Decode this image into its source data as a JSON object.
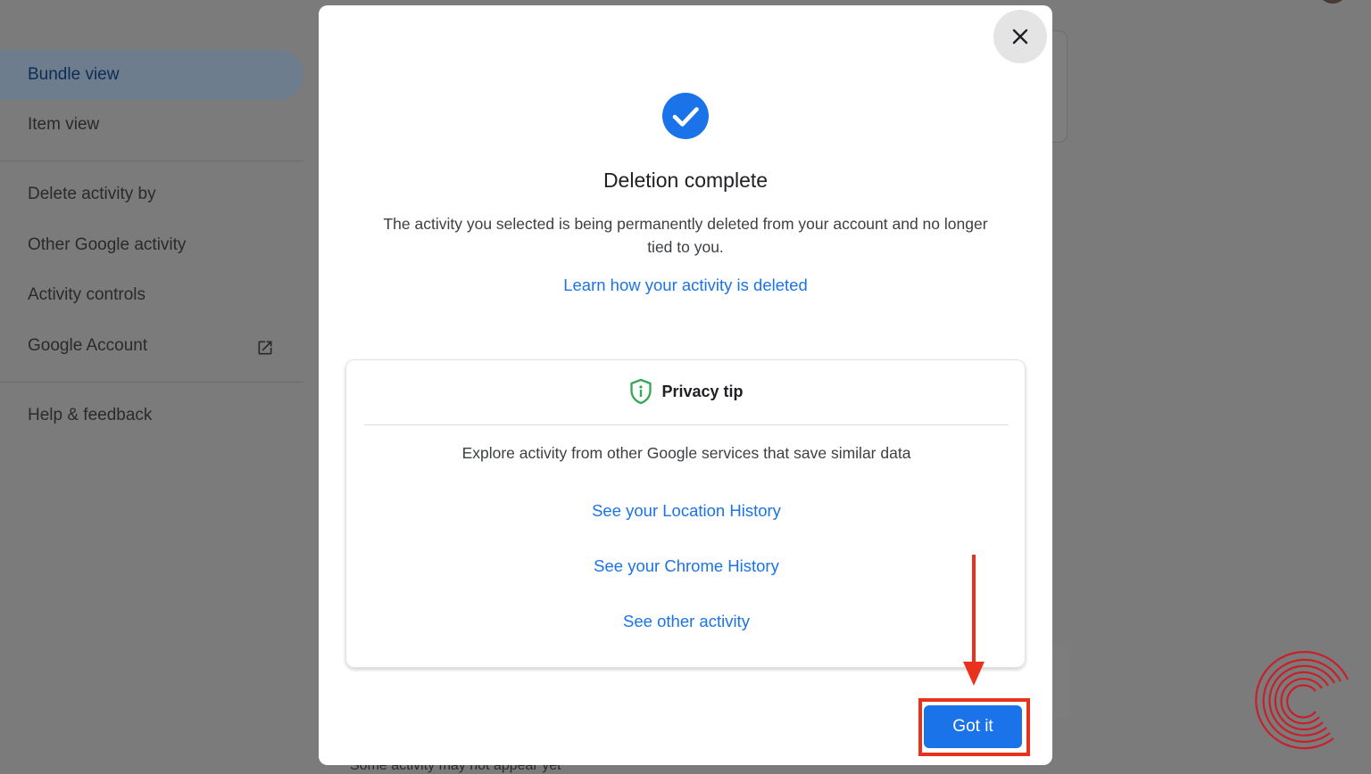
{
  "background": {
    "sidebar": {
      "items": [
        {
          "label": "Bundle view",
          "active": true
        },
        {
          "label": "Item view"
        },
        {
          "label": "Delete activity by"
        },
        {
          "label": "Other Google activity"
        },
        {
          "label": "Activity controls"
        },
        {
          "label": "Google Account",
          "icon": "open-in-new-icon"
        },
        {
          "label": "Help & feedback"
        }
      ]
    },
    "bottom_text": "Some activity may not appear yet"
  },
  "dialog": {
    "close_icon": "close-icon",
    "status_icon": "check-circle-icon",
    "title": "Deletion complete",
    "description": "The activity you selected is being permanently deleted from your account and no longer tied to you.",
    "learn_link": "Learn how your activity is deleted",
    "privacy_tip": {
      "icon": "shield-info-icon",
      "title": "Privacy tip",
      "text": "Explore activity from other Google services that save similar data",
      "links": [
        "See your Location History",
        "See your Chrome History",
        "See other activity"
      ]
    },
    "got_it_label": "Got it"
  },
  "colors": {
    "accent": "#1a73e8",
    "check_icon": "#1a73e8",
    "shield_icon": "#34a853",
    "annotation": "#e8321e",
    "overlay": "#7b7b7b"
  }
}
